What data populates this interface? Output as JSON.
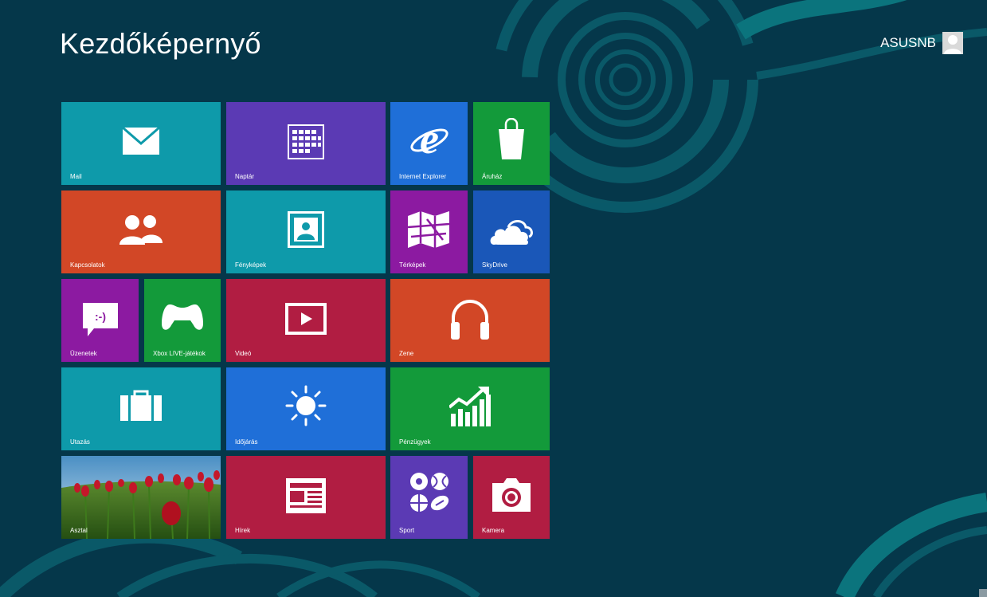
{
  "header": {
    "title": "Kezdőképernyő"
  },
  "user": {
    "name": "ASUSNB"
  },
  "tiles": {
    "mail": {
      "label": "Mail",
      "color": "#0e9aaa",
      "icon": "mail-icon"
    },
    "calendar": {
      "label": "Naptár",
      "color": "#5b3ab4",
      "icon": "calendar-icon"
    },
    "ie": {
      "label": "Internet Explorer",
      "color": "#1f6fd8",
      "icon": "internet-explorer-icon"
    },
    "store": {
      "label": "Áruház",
      "color": "#139a3a",
      "icon": "shopping-bag-icon"
    },
    "people": {
      "label": "Kapcsolatok",
      "color": "#d24726",
      "icon": "people-icon"
    },
    "photos": {
      "label": "Fényképek",
      "color": "#0e9aaa",
      "icon": "photo-icon"
    },
    "maps": {
      "label": "Térképek",
      "color": "#8c1aa1",
      "icon": "map-icon"
    },
    "skydrive": {
      "label": "SkyDrive",
      "color": "#1a57b8",
      "icon": "cloud-icon"
    },
    "messaging": {
      "label": "Üzenetek",
      "color": "#8c1aa1",
      "icon": "message-icon"
    },
    "xbox": {
      "label": "Xbox LIVE-játékok",
      "color": "#139a3a",
      "icon": "gamepad-icon"
    },
    "video": {
      "label": "Videó",
      "color": "#b11d42",
      "icon": "play-icon"
    },
    "music": {
      "label": "Zene",
      "color": "#d24726",
      "icon": "headphones-icon"
    },
    "travel": {
      "label": "Utazás",
      "color": "#0e9aaa",
      "icon": "suitcase-icon"
    },
    "weather": {
      "label": "Időjárás",
      "color": "#1f6fd8",
      "icon": "sun-icon"
    },
    "finance": {
      "label": "Pénzügyek",
      "color": "#139a3a",
      "icon": "chart-up-icon"
    },
    "desktop": {
      "label": "Asztal",
      "color": "#6aa3c8",
      "icon": "tulip-photo"
    },
    "news": {
      "label": "Hírek",
      "color": "#b11d42",
      "icon": "newspaper-icon"
    },
    "sports": {
      "label": "Sport",
      "color": "#5b3ab4",
      "icon": "sports-balls-icon"
    },
    "camera": {
      "label": "Kamera",
      "color": "#b11d42",
      "icon": "camera-icon"
    }
  }
}
